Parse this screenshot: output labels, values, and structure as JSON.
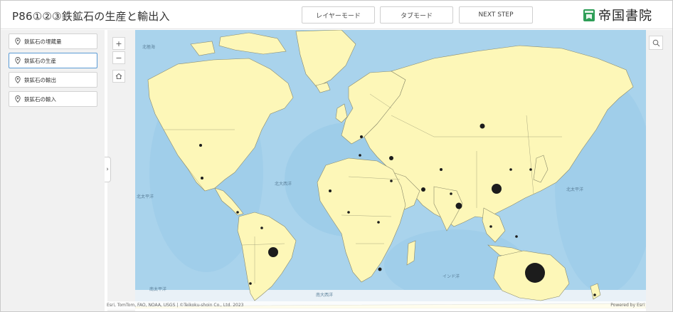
{
  "header": {
    "title": "P86①②③鉄鉱石の生産と輸出入",
    "buttons": {
      "layer_mode": "レイヤーモード",
      "tab_mode": "タブモード",
      "next_step": "NEXT STEP"
    },
    "brand": "帝国書院"
  },
  "sidebar": {
    "items": [
      {
        "label": "鉄鉱石の埋蔵量",
        "icon": "map-pin-icon",
        "active": false
      },
      {
        "label": "鉄鉱石の生産",
        "icon": "map-pin-icon",
        "active": true
      },
      {
        "label": "鉄鉱石の輸出",
        "icon": "map-pin-icon",
        "active": false
      },
      {
        "label": "鉄鉱石の輸入",
        "icon": "map-pin-icon",
        "active": false
      }
    ],
    "collapse_glyph": "›"
  },
  "map_tools": {
    "zoom_in": "+",
    "zoom_out": "−",
    "home_icon": "home-icon",
    "search_icon": "search-icon"
  },
  "map": {
    "colors": {
      "ocean": "#a9d3ec",
      "deep_ocean": "#8fc3e4",
      "land": "#fdf7b8",
      "border": "#8a8a6a",
      "dot": "#1c1c1c"
    },
    "labels": {
      "arctic": "北極海",
      "n_atlantic": "北大西洋",
      "pacific_left": "北太平洋",
      "pacific_right": "北太平洋",
      "indian": "インド洋",
      "s_atlantic": "南大西洋",
      "s_pacific": "南太平洋"
    }
  },
  "attribution": {
    "text": "Esri, TomTom, FAO, NOAA, USGS | ©Teikoku-shoin Co., Ltd. 2023",
    "powered": "Powered by Esri"
  }
}
